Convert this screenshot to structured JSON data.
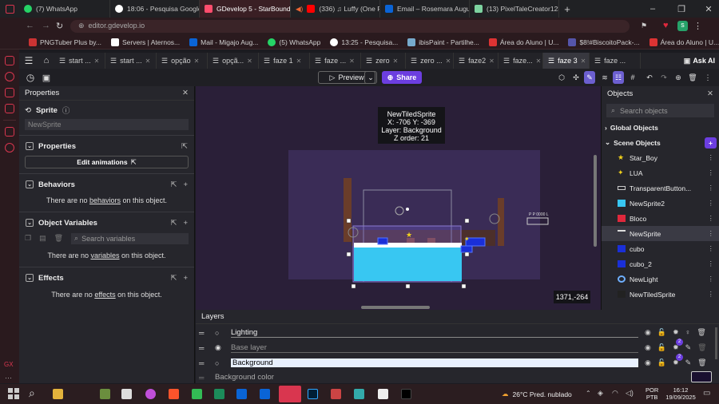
{
  "browser": {
    "tabs": [
      {
        "label": "(7) WhatsApp",
        "color": "#25d366"
      },
      {
        "label": "18:06 - Pesquisa Google",
        "color": "#4285f4"
      },
      {
        "label": "GDevelop 5 - StarBound",
        "color": "#ff4d6d",
        "active": true
      },
      {
        "label": "(336) ♫ Luffy (One P",
        "color": "#ff0000"
      },
      {
        "label": "Email – Rosemara August",
        "color": "#0a64d6"
      },
      {
        "label": "(13) PixelTaleCreator123",
        "color": "#7dd3a0"
      }
    ],
    "url": "editor.gdevelop.io",
    "bookmarks": [
      "PNGTuber Plus by...",
      "Servers | Aternos...",
      "Mail - Migajo Aug...",
      "(5) WhatsApp",
      "13:25 - Pesquisa...",
      "ibisPaint - Partilhe...",
      "Área do Aluno | U...",
      "$8!#BiscoitoPack-...",
      "Área do Aluno | U..."
    ]
  },
  "editor": {
    "scene_tabs": [
      "start ...",
      "start ...",
      "opção",
      "opçã...",
      "faze 1",
      "faze ...",
      "zero",
      "zero ...",
      "faze2",
      "faze...",
      "faze 3",
      "faze ..."
    ],
    "active_tab_index": 10,
    "ask_ai": "Ask AI",
    "preview": "Preview",
    "share": "Share"
  },
  "properties": {
    "title": "Properties",
    "object_type": "Sprite",
    "object_name": "NewSprite",
    "sections": {
      "properties": "Properties",
      "edit_animations": "Edit animations",
      "behaviors": "Behaviors",
      "behaviors_empty_pre": "There are no ",
      "behaviors_link": "behaviors",
      "behaviors_empty_post": " on this object.",
      "variables": "Object Variables",
      "search_variables": "Search variables",
      "variables_empty_pre": "There are no ",
      "variables_link": "variables",
      "variables_empty_post": " on this object.",
      "effects": "Effects",
      "effects_empty_pre": "There are no ",
      "effects_link": "effects",
      "effects_empty_post": " on this object."
    }
  },
  "canvas": {
    "tooltip": [
      "NewTiledSprite",
      "X: -706  Y: -369",
      "Layer: Background",
      "Z order: 21"
    ],
    "coords": "1371,-264",
    "small_label": "P P 0000 L"
  },
  "objects": {
    "title": "Objects",
    "search_placeholder": "Search objects",
    "global": "Global Objects",
    "scene": "Scene Objects",
    "items": [
      {
        "name": "Star_Boy",
        "icon": "star-icon",
        "color": "#f2d21b"
      },
      {
        "name": "LUA",
        "icon": "moon-icon",
        "color": "#f2d21b"
      },
      {
        "name": "TransparentButton...",
        "icon": "button-icon",
        "color": "#cccccc"
      },
      {
        "name": "NewSprite2",
        "icon": "water-icon",
        "color": "#38c7f2"
      },
      {
        "name": "Bloco",
        "icon": "block-icon",
        "color": "#e0283c"
      },
      {
        "name": "NewSprite",
        "icon": "sprite-icon",
        "color": "#3a3a44",
        "selected": true
      },
      {
        "name": "cubo",
        "icon": "cube-icon",
        "color": "#1a2fd8"
      },
      {
        "name": "cubo_2",
        "icon": "cube-icon",
        "color": "#1a2fd8"
      },
      {
        "name": "NewLight",
        "icon": "light-icon",
        "color": "#6fb0ff"
      },
      {
        "name": "NewTiledSprite",
        "icon": "tiled-icon",
        "color": "#222222"
      }
    ]
  },
  "layers": {
    "title": "Layers",
    "rows": [
      {
        "name": "Lighting",
        "badge": ""
      },
      {
        "name": "Base layer",
        "badge": "2"
      },
      {
        "name": "Background",
        "badge": "2"
      }
    ],
    "background_color": "Background color"
  },
  "taskbar": {
    "weather": "26°C  Pred. nublado",
    "lang": "POR",
    "lang2": "PTB",
    "time": "16:12",
    "date": "19/09/2025"
  }
}
